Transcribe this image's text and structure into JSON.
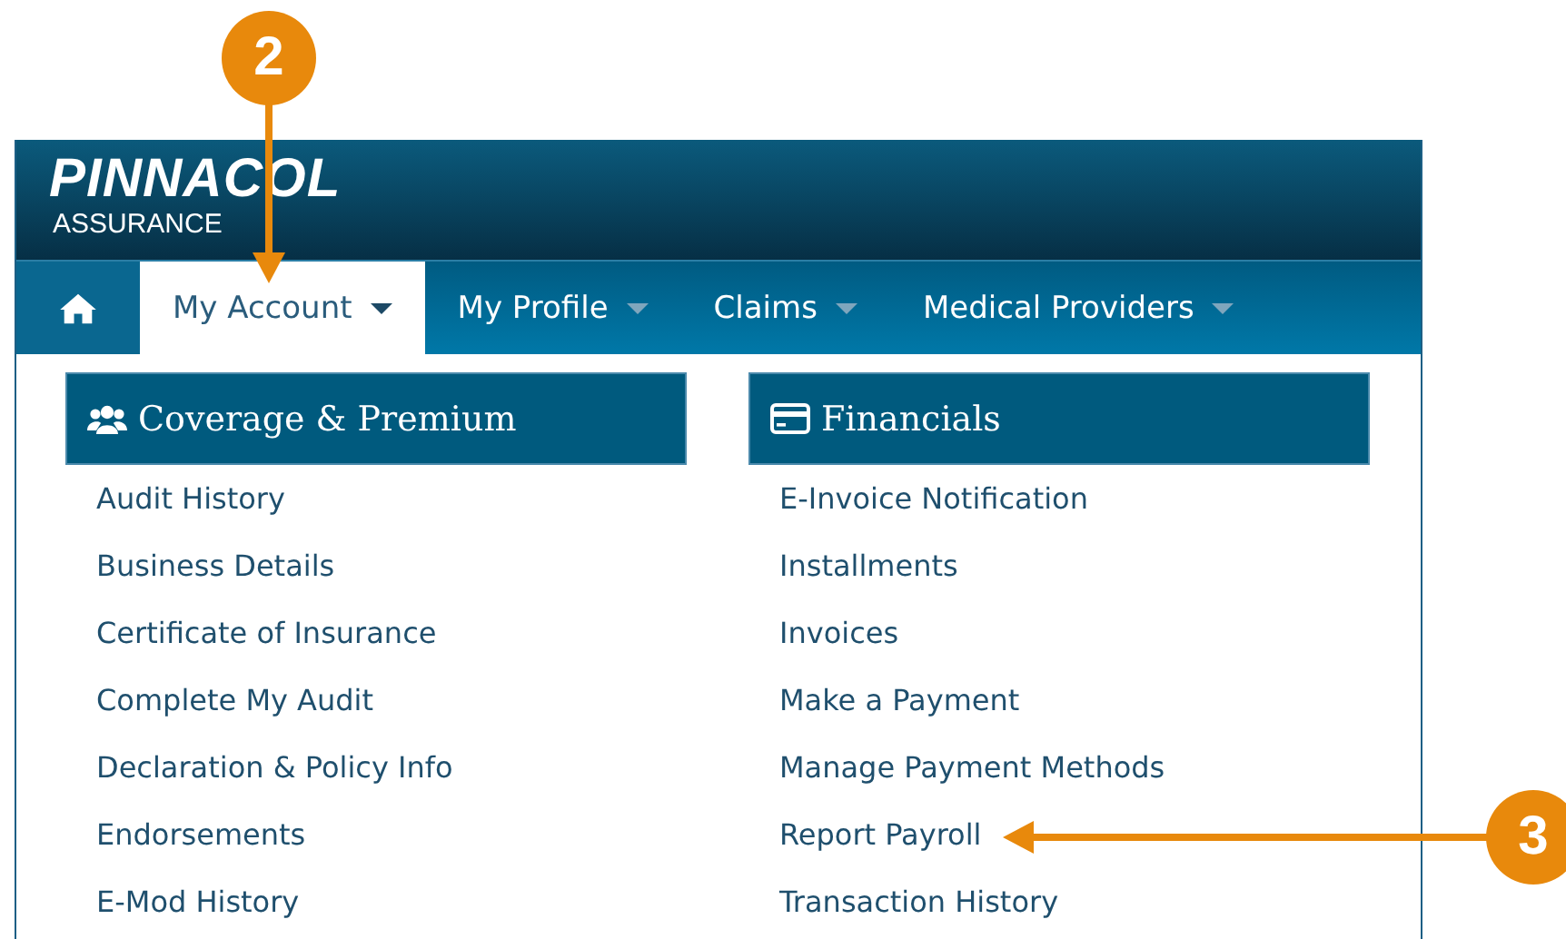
{
  "header": {
    "logo": "PINNACOL",
    "logo_subtitle": "ASSURANCE"
  },
  "nav": {
    "tabs": [
      {
        "label": "My Account",
        "selected": true
      },
      {
        "label": "My Profile",
        "selected": false
      },
      {
        "label": "Claims",
        "selected": false
      },
      {
        "label": "Medical Providers",
        "selected": false
      }
    ]
  },
  "menu_columns": [
    {
      "title": "Coverage & Premium",
      "items": [
        "Audit History",
        "Business Details",
        "Certificate of Insurance",
        "Complete My Audit",
        "Declaration & Policy Info",
        "Endorsements",
        "E-Mod History"
      ]
    },
    {
      "title": "Financials",
      "items": [
        "E-Invoice Notification",
        "Installments",
        "Invoices",
        "Make a Payment",
        "Manage Payment Methods",
        "Report Payroll",
        "Transaction History"
      ]
    }
  ],
  "callouts": [
    {
      "label": "2"
    },
    {
      "label": "3"
    }
  ]
}
